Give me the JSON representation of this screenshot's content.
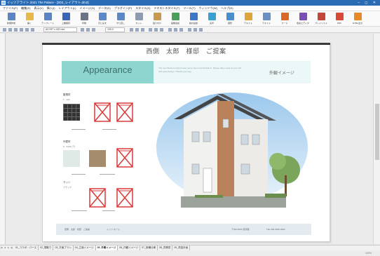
{
  "window": {
    "title": "イッツアライト 2021 The Palace - [3D2_レイアウト.dm2]",
    "controls": "‒ ◻ ✕"
  },
  "menu": [
    "ファイル(F)",
    "編集(E)",
    "表示(V)",
    "挿入(I)",
    "レイアウト(L)",
    "イメージ(G)",
    "データ(D)",
    "プラグイン(P)",
    "スタイル(S)",
    "テキストスタイル(T)",
    "ツール(T)",
    "ウィンドウ(W)",
    "ヘルプ(H)"
  ],
  "ribbon": [
    {
      "label": "新規作成",
      "icon": "new-file-icon",
      "color": "#5c84c4"
    },
    {
      "label": "開く",
      "icon": "open-folder-icon",
      "color": "#e6b94a"
    },
    {
      "label": "テンプレート",
      "icon": "template-icon",
      "color": "#5c84c4"
    },
    {
      "label": "上書保存",
      "icon": "save-icon",
      "color": "#3b66b5"
    },
    {
      "label": "印刷",
      "icon": "print-icon",
      "color": "#6b7485"
    },
    {
      "label": "元に戻す",
      "icon": "undo-icon",
      "color": "#5a88c8"
    },
    {
      "label": "やり直し",
      "icon": "redo-icon",
      "color": "#5a88c8"
    },
    {
      "label": "カット",
      "icon": "cut-icon",
      "color": "#8f9bb0"
    },
    {
      "label": "貼り付け",
      "icon": "paste-icon",
      "color": "#c79b4e"
    },
    {
      "label": "画像追加",
      "icon": "image-icon",
      "color": "#4aa05a"
    },
    {
      "label": "線の追加",
      "icon": "pen-icon",
      "color": "#3d78c7"
    },
    {
      "label": "矢印",
      "icon": "arrow-icon",
      "color": "#3aa0d0"
    },
    {
      "label": "図形",
      "icon": "shape-icon",
      "color": "#4a8ed0"
    },
    {
      "label": "テキスト",
      "icon": "text-box-icon",
      "color": "#e0a53a"
    },
    {
      "label": "テキスト",
      "icon": "text-frame-icon",
      "color": "#6a8fc5"
    },
    {
      "label": "ワード",
      "icon": "wordart-icon",
      "color": "#d8692a"
    },
    {
      "label": "色彩エディタ",
      "icon": "color-editor-icon",
      "color": "#7a4fb5"
    },
    {
      "label": "プレイリスト",
      "icon": "playlist-icon",
      "color": "#c4463b"
    },
    {
      "label": "PDF",
      "icon": "pdf-icon",
      "color": "#d84a36"
    },
    {
      "label": "HTML出力",
      "icon": "html-export-icon",
      "color": "#e68a2a"
    }
  ],
  "toolbar2": {
    "page_size": "A3 297 x 420 mm",
    "zoom": "100.0"
  },
  "document": {
    "heading": "西側　太郎　様邸　ご提案",
    "band_title": "Appearance",
    "band_note": "The new Western-style house you've been comfortable in. Please take a look at your self with good design. Thanks your way.",
    "band_label": "外観イメージ",
    "sections": [
      {
        "label": "屋根材",
        "sub": "T - 100"
      },
      {
        "label": "外壁材",
        "sub": "S - 6104 (ア)"
      },
      {
        "label": "サッシ",
        "sub": "ブラック"
      }
    ],
    "footer_left": "西側　太郎　様邸　ご提案",
    "footer_mid": "イッツ ホーム",
    "footer_right_1": "〒000-0000 東京都",
    "footer_right_2": "TEL 000-0000-0000"
  },
  "tabs": {
    "items": [
      "01_コラボ・パース",
      "02_間取り",
      "03_平面プラン",
      "04_立面イメージ",
      "05_外観イメージ",
      "06_内観イメージ",
      "07_設備仕様",
      "08_見積書",
      "09_資金計画"
    ],
    "active_index": 4
  },
  "status": "100%"
}
